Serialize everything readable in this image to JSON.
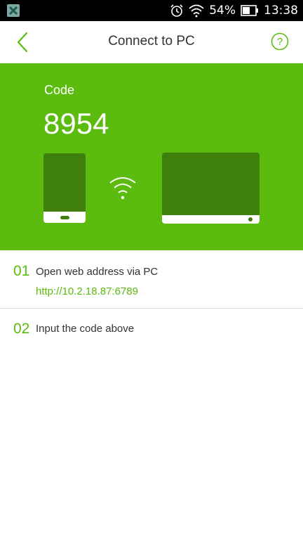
{
  "status_bar": {
    "battery_percent": "54%",
    "time": "13:38",
    "icons": [
      "app-notification-icon",
      "alarm-icon",
      "wifi-icon",
      "battery-icon"
    ]
  },
  "header": {
    "title": "Connect to PC",
    "back_icon": "chevron-left-icon",
    "help_icon": "question-circle-icon"
  },
  "hero": {
    "code_label": "Code",
    "code_value": "8954",
    "icons": [
      "phone-icon",
      "wifi-signal-icon",
      "laptop-icon"
    ]
  },
  "steps": [
    {
      "number": "01",
      "text": "Open web address via PC",
      "link": "http://10.2.18.87:6789"
    },
    {
      "number": "02",
      "text": "Input the code above"
    }
  ],
  "colors": {
    "accent": "#5bbb0e",
    "device_dark": "#3f7f0d",
    "text": "#333333",
    "status_bar": "#000000"
  }
}
